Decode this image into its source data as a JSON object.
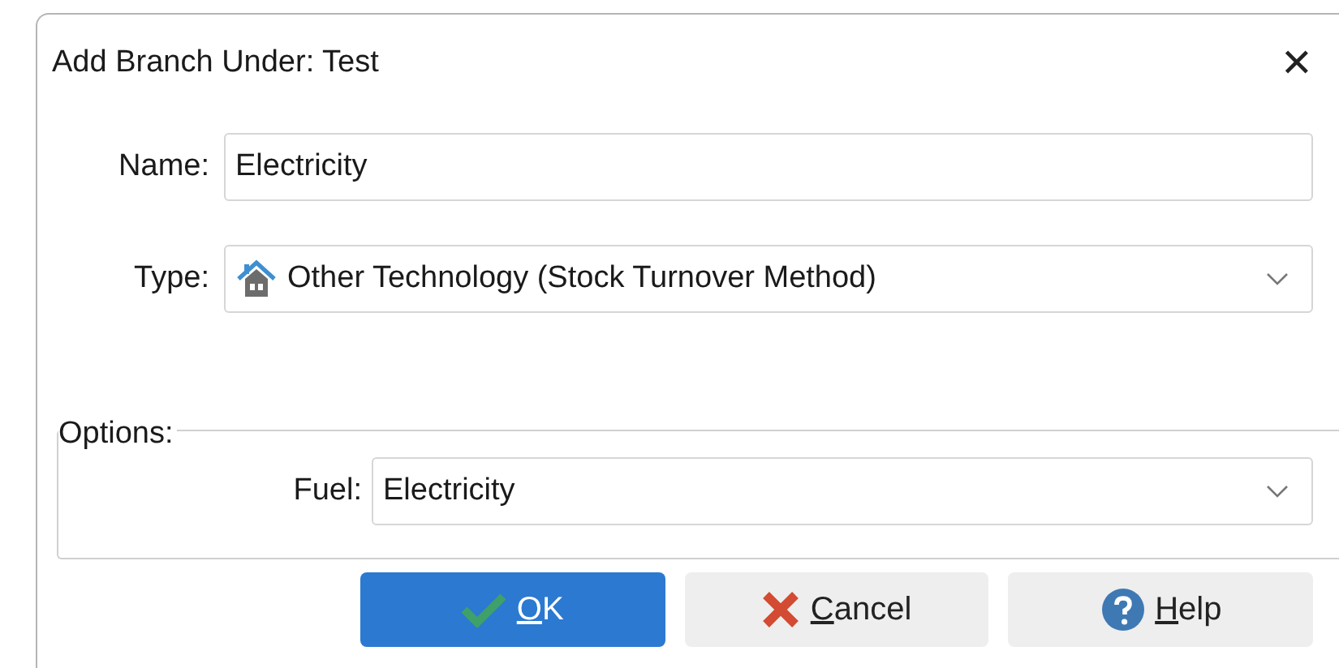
{
  "window": {
    "title": "Add Branch Under: Test",
    "close": "✕"
  },
  "name_field": {
    "label": "Name:",
    "value": "Electricity"
  },
  "type_field": {
    "label": "Type:",
    "value": "Other Technology (Stock Turnover Method)"
  },
  "options": {
    "legend": "Options:",
    "fuel": {
      "label": "Fuel:",
      "value": "Electricity"
    }
  },
  "buttons": [
    {
      "kind": "ok",
      "accel": "O",
      "rest": "K"
    },
    {
      "kind": "cancel",
      "accel": "C",
      "rest": "ancel"
    },
    {
      "kind": "help",
      "accel": "H",
      "rest": "elp"
    }
  ]
}
